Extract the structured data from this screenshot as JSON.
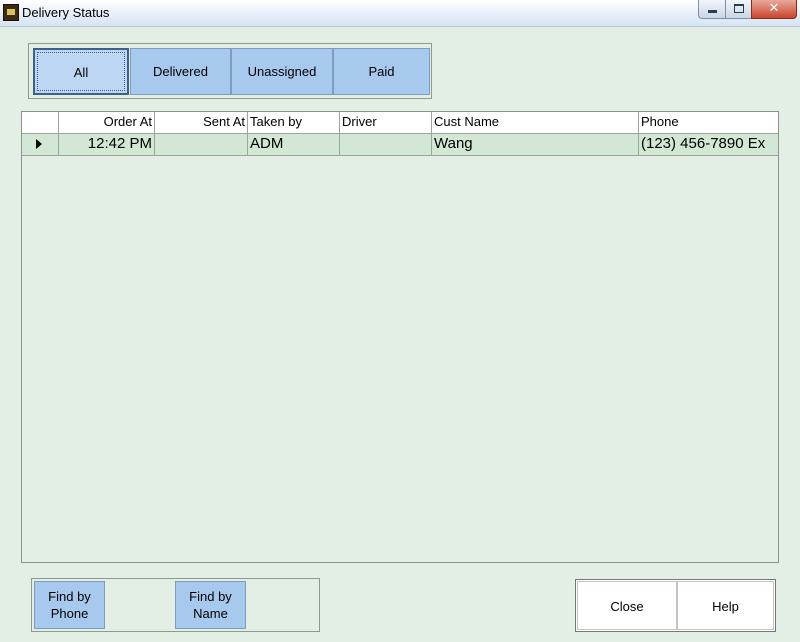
{
  "window": {
    "title": "Delivery Status"
  },
  "filters": {
    "items": [
      {
        "label": "All",
        "active": true
      },
      {
        "label": "Delivered",
        "active": false
      },
      {
        "label": "Unassigned",
        "active": false
      },
      {
        "label": "Paid",
        "active": false
      }
    ]
  },
  "grid": {
    "columns": [
      "Order At",
      "Sent At",
      "Taken by",
      "Driver",
      "Cust Name",
      "Phone"
    ],
    "rows": [
      {
        "order_at": "12:42 PM",
        "sent_at": "",
        "taken_by": "ADM",
        "driver": "",
        "cust_name": "Wang",
        "phone": "(123) 456-7890 Ex"
      }
    ]
  },
  "find": {
    "by_phone": "Find by\nPhone",
    "by_name": "Find by\nName"
  },
  "actions": {
    "close": "Close",
    "help": "Help"
  },
  "colors": {
    "window_bg": "#e3efe4",
    "button_blue": "#a8c9ee",
    "selected_row": "#d3e8d4"
  }
}
